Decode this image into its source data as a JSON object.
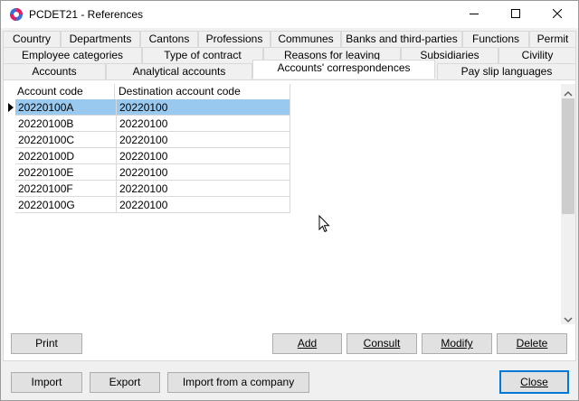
{
  "window": {
    "title": "PCDET21 - References"
  },
  "tabs": {
    "row1": [
      "Country",
      "Departments",
      "Cantons",
      "Professions",
      "Communes",
      "Banks and third-parties",
      "Functions",
      "Permit"
    ],
    "row2": [
      "Employee categories",
      "Type of contract",
      "Reasons for leaving",
      "Subsidiaries",
      "Civility"
    ],
    "row3": [
      "Accounts",
      "Analytical accounts",
      "Accounts' correspondences",
      "Pay slip languages"
    ],
    "active": "Accounts' correspondences"
  },
  "grid": {
    "columns": [
      "Account code",
      "Destination account code"
    ],
    "rows": [
      {
        "account": "20220100A",
        "destination": "20220100"
      },
      {
        "account": "20220100B",
        "destination": "20220100"
      },
      {
        "account": "20220100C",
        "destination": "20220100"
      },
      {
        "account": "20220100D",
        "destination": "20220100"
      },
      {
        "account": "20220100E",
        "destination": "20220100"
      },
      {
        "account": "20220100F",
        "destination": "20220100"
      },
      {
        "account": "20220100G",
        "destination": "20220100"
      }
    ]
  },
  "buttons": {
    "print": "Print",
    "add": "Add",
    "consult": "Consult",
    "modify": "Modify",
    "delete": "Delete",
    "import": "Import",
    "export": "Export",
    "import_company": "Import from a company",
    "close": "Close"
  },
  "colors": {
    "selection": "#99c9ef",
    "default_button_border": "#0078d7"
  }
}
